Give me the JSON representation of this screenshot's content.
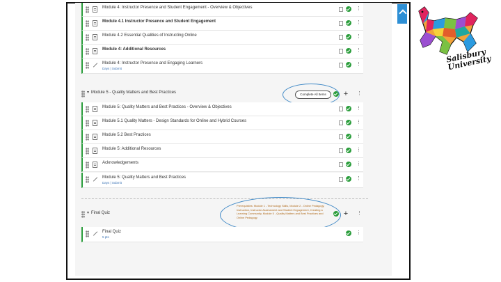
{
  "module4": {
    "items": [
      {
        "title": "Module 4: Instructor Presence and Student Engagement - Overview & Objectives",
        "bold": false
      },
      {
        "title": "Module 4.1 Instructor Presence and Student Engagement",
        "bold": true
      },
      {
        "title": "Module 4.2 Essential Qualities of Instructing Online",
        "bold": false
      },
      {
        "title": "Module 4: Additional Resources",
        "bold": true
      },
      {
        "title": "Module 4: Instructor Presence and Engaging Learners",
        "bold": false,
        "sub": "Days | Submit"
      }
    ]
  },
  "module5": {
    "title": "Module 5 - Quality Matters and Best Practices",
    "requirement": "Complete All Items",
    "items": [
      {
        "title": "Module 5: Quality Matters and Best Practices - Overview & Objectives"
      },
      {
        "title": "Module 5.1 Quality Matters - Design Standards for Online and Hybrid Courses"
      },
      {
        "title": "Module 5.2 Best Practices"
      },
      {
        "title": "Module 5: Additional Resources"
      },
      {
        "title": "Acknowledgements"
      },
      {
        "title": "Module 5: Quality Matters and Best Practices",
        "sub": "Days | Submit"
      }
    ]
  },
  "final": {
    "title": "Final Quiz",
    "prereq": "Prerequisites: Module 1 - Technology Skills, Module 2 - Online Pedagogy, Instruction, Instructor Assessment and Student Engagement, Creating a Learning Community, Module 5 - Quality Matters and Best Practices and Online Pedagogy",
    "item": {
      "title": "Final Quiz",
      "sub": "5 pts"
    }
  },
  "logo": {
    "line1": "Salisbury",
    "line2": "University"
  },
  "colors": {
    "green": "#2a9d3b",
    "blue": "#2d8fd5",
    "oval": "#3e88c6"
  }
}
